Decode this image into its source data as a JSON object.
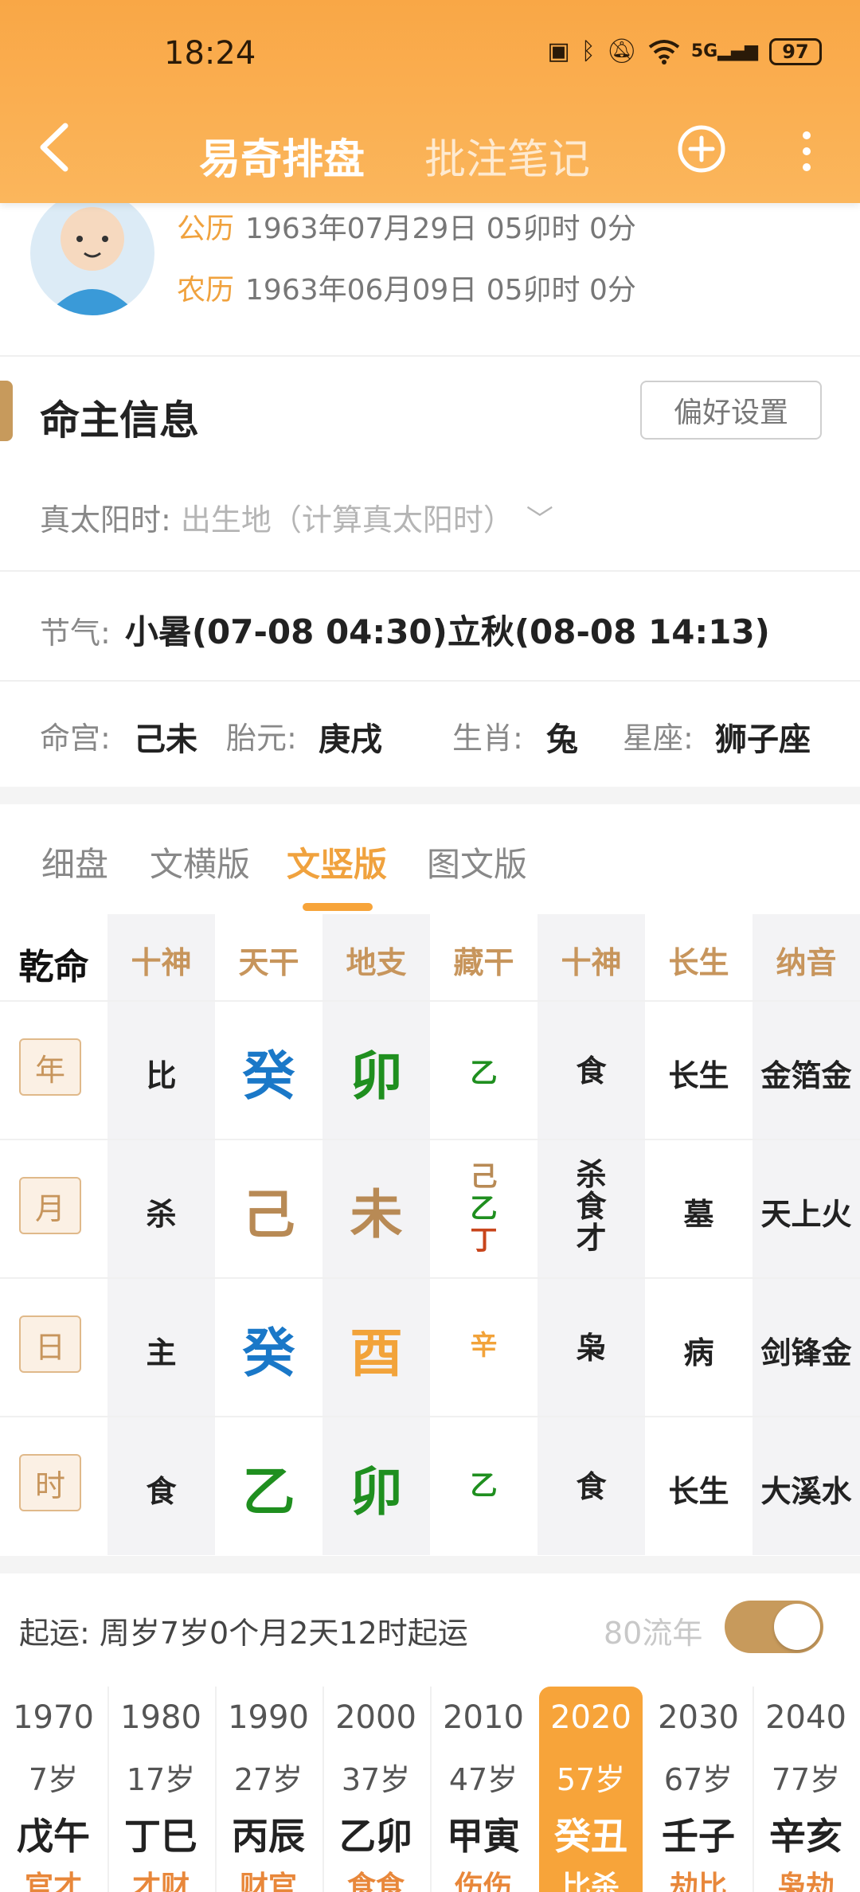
{
  "status": {
    "time": "18:24",
    "battery": "97",
    "network": "5G"
  },
  "nav": {
    "active_tab": "易奇排盘",
    "inactive_tab": "批注笔记"
  },
  "profile": {
    "solar_label": "公历",
    "solar_value": "1963年07月29日 05卯时 0分",
    "lunar_label": "农历",
    "lunar_value": "1963年06月09日 05卯时 0分"
  },
  "info": {
    "title": "命主信息",
    "pref_button": "偏好设置",
    "true_solar_label": "真太阳时:",
    "true_solar_placeholder": "出生地（计算真太阳时）",
    "jieqi_label": "节气:",
    "jieqi_value": "小暑(07-08 04:30)立秋(08-08 14:13)",
    "minggong_label": "命宫:",
    "minggong_value": "己未",
    "taiyuan_label": "胎元:",
    "taiyuan_value": "庚戌",
    "shengxiao_label": "生肖:",
    "shengxiao_value": "兔",
    "xingzuo_label": "星座:",
    "xingzuo_value": "狮子座"
  },
  "tabs": [
    "细盘",
    "文横版",
    "文竖版",
    "图文版"
  ],
  "table": {
    "corner": "乾命",
    "headers": [
      "十神",
      "天干",
      "地支",
      "藏干",
      "十神",
      "长生",
      "纳音"
    ],
    "rows": [
      {
        "pillar": "年",
        "shishen": "比",
        "tiangan": "癸",
        "dizhi": "卯",
        "canggan": [
          "乙"
        ],
        "shishen2": [
          "食"
        ],
        "changsheng": "长生",
        "nayin": "金箔金"
      },
      {
        "pillar": "月",
        "shishen": "杀",
        "tiangan": "己",
        "dizhi": "未",
        "canggan": [
          "己",
          "乙",
          "丁"
        ],
        "shishen2": [
          "杀",
          "食",
          "才"
        ],
        "changsheng": "墓",
        "nayin": "天上火"
      },
      {
        "pillar": "日",
        "shishen": "主",
        "tiangan": "癸",
        "dizhi": "酉",
        "canggan": [
          "辛"
        ],
        "shishen2": [
          "枭"
        ],
        "changsheng": "病",
        "nayin": "剑锋金"
      },
      {
        "pillar": "时",
        "shishen": "食",
        "tiangan": "乙",
        "dizhi": "卯",
        "canggan": [
          "乙"
        ],
        "shishen2": [
          "食"
        ],
        "changsheng": "长生",
        "nayin": "大溪水"
      }
    ]
  },
  "qiyun": {
    "text": "起运:  周岁7岁0个月2天12时起运",
    "liunian_label": "80流年",
    "liunian_on": true
  },
  "dayun": [
    {
      "year": "1970",
      "age": "7岁",
      "ganzhi": "戊午",
      "god": "官才"
    },
    {
      "year": "1980",
      "age": "17岁",
      "ganzhi": "丁巳",
      "god": "才财"
    },
    {
      "year": "1990",
      "age": "27岁",
      "ganzhi": "丙辰",
      "god": "财官"
    },
    {
      "year": "2000",
      "age": "37岁",
      "ganzhi": "乙卯",
      "god": "食食"
    },
    {
      "year": "2010",
      "age": "47岁",
      "ganzhi": "甲寅",
      "god": "伤伤"
    },
    {
      "year": "2020",
      "age": "57岁",
      "ganzhi": "癸丑",
      "god": "比杀"
    },
    {
      "year": "2030",
      "age": "67岁",
      "ganzhi": "壬子",
      "god": "劫比"
    },
    {
      "year": "2040",
      "age": "77岁",
      "ganzhi": "辛亥",
      "god": "枭劫"
    }
  ],
  "dayun_selected": "2020"
}
